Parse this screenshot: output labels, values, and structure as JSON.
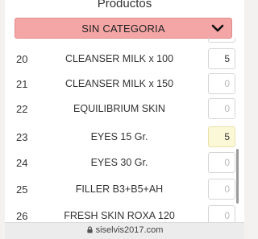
{
  "header": {
    "title": "Productos"
  },
  "category": {
    "label": "SIN CATEGORIA",
    "icon": "chevron-down-icon"
  },
  "products": [
    {
      "num": "20",
      "name": "CLEANSER MILK x 100",
      "qty": "5",
      "state": "filled"
    },
    {
      "num": "21",
      "name": "CLEANSER MILK x 150",
      "qty": "0",
      "state": "empty"
    },
    {
      "num": "22",
      "name": "EQUILIBRIUM SKIN",
      "qty": "0",
      "state": "empty"
    },
    {
      "num": "23",
      "name": "EYES 15 Gr.",
      "qty": "5",
      "state": "highlight"
    },
    {
      "num": "24",
      "name": "EYES 30 Gr.",
      "qty": "0",
      "state": "empty"
    },
    {
      "num": "25",
      "name": "FILLER B3+B5+AH",
      "qty": "0",
      "state": "empty"
    },
    {
      "num": "26",
      "name": "FRESH SKIN ROXA 120",
      "qty": "0",
      "state": "empty"
    }
  ],
  "browser": {
    "url": "siselvis2017.com",
    "icon": "lock-icon"
  },
  "colors": {
    "category_bg": "#f4a6a6",
    "highlight_bg": "#fbf8d8"
  }
}
